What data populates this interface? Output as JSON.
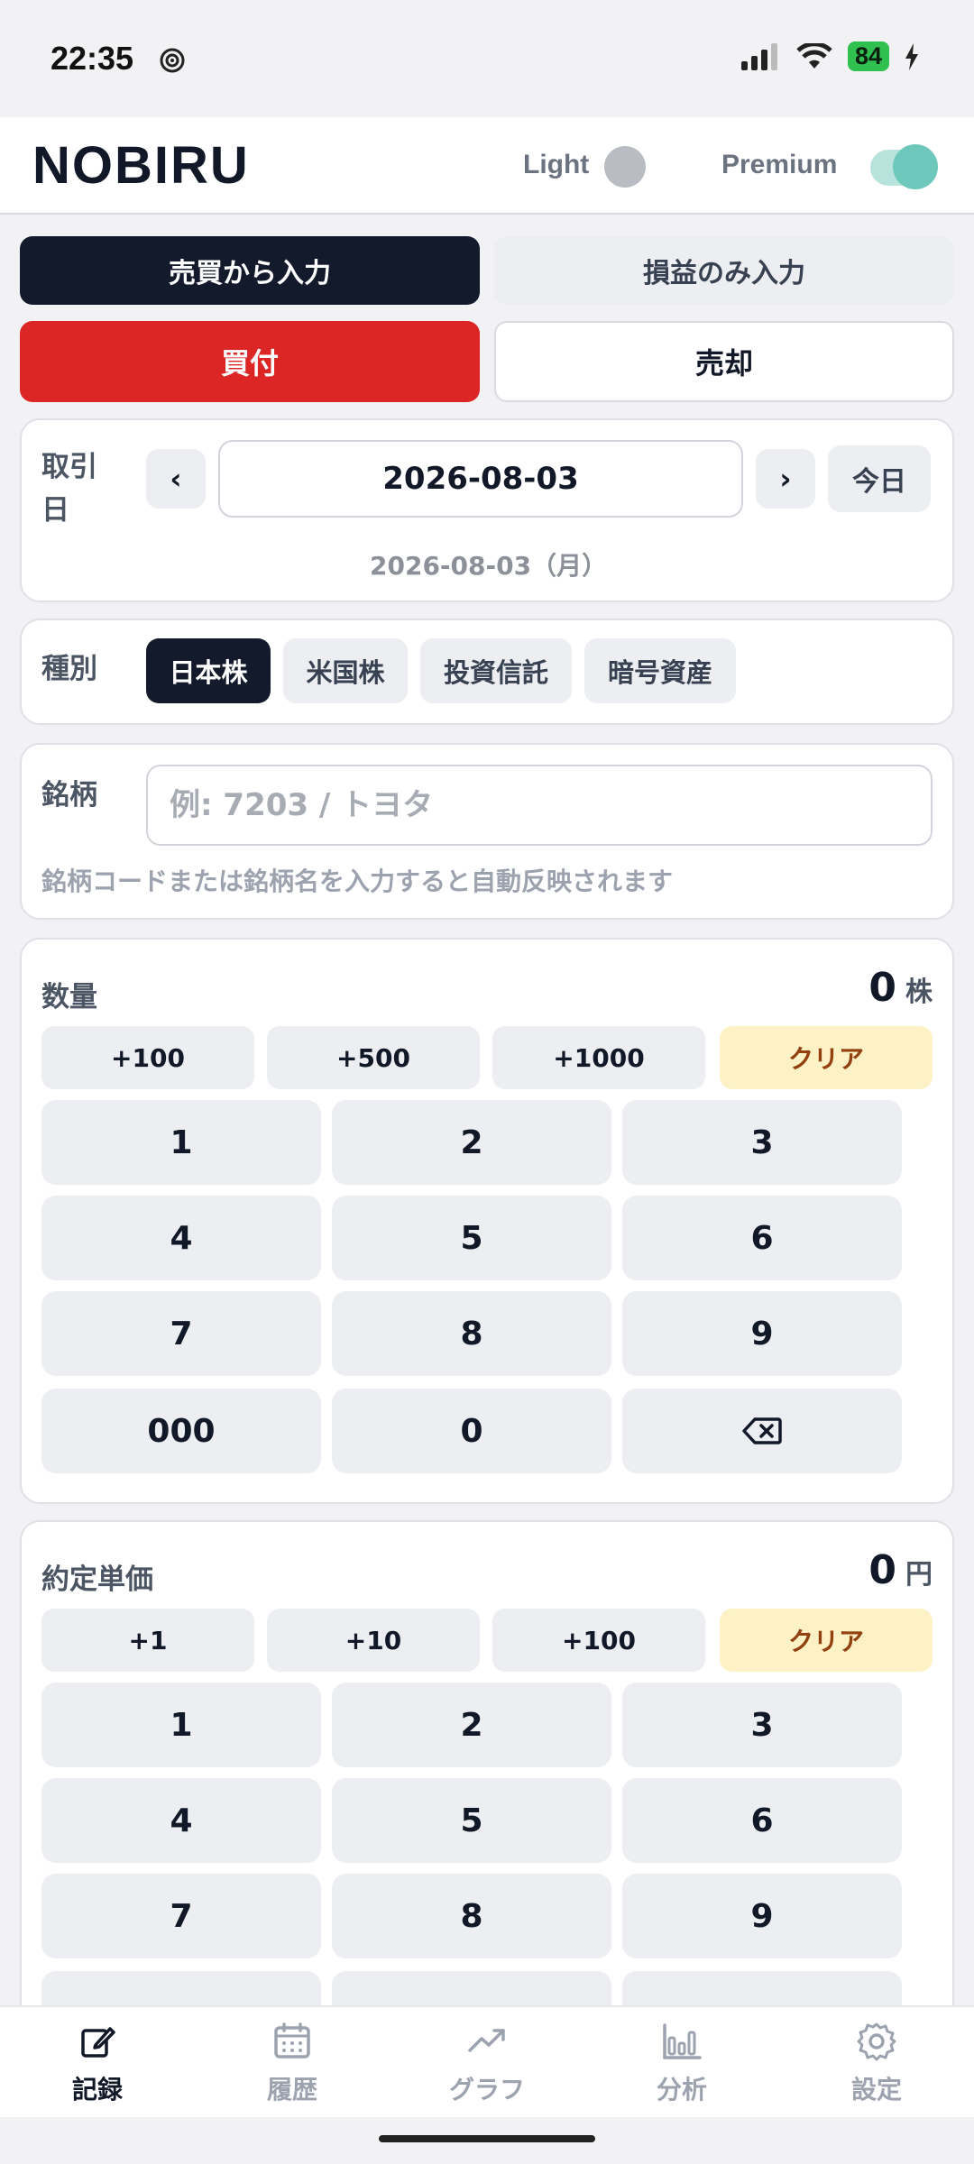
{
  "status_bar": {
    "time": "22:35",
    "battery": "84"
  },
  "header": {
    "logo": "NOBIRU",
    "light_label": "Light",
    "premium_label": "Premium"
  },
  "input_mode": {
    "tabs": [
      "売買から入力",
      "損益のみ入力"
    ],
    "selected": 0
  },
  "trade_side": {
    "buy": "買付",
    "sell": "売却",
    "selected": "buy"
  },
  "date_card": {
    "label": "取引日",
    "label_line1": "取引",
    "label_line2": "日",
    "prev": "‹",
    "value": "2026-08-03",
    "next": "›",
    "today": "今日",
    "formatted": "2026-08-03（月）"
  },
  "type_card": {
    "label": "種別",
    "options": [
      "日本株",
      "米国株",
      "投資信託",
      "暗号資産"
    ],
    "selected": 0
  },
  "ticker_card": {
    "label": "銘柄",
    "placeholder": "例: 7203 / トヨタ",
    "value": "",
    "hint": "銘柄コードまたは銘柄名を入力すると自動反映されます"
  },
  "quantity_card": {
    "label": "数量",
    "value": "0",
    "unit": "株",
    "quick": [
      "+100",
      "+500",
      "+1000"
    ],
    "clear": "クリア",
    "keys": [
      "1",
      "2",
      "3",
      "4",
      "5",
      "6",
      "7",
      "8",
      "9",
      "000",
      "0",
      "⌫"
    ]
  },
  "price_card": {
    "label": "約定単価",
    "value": "0",
    "unit": "円",
    "quick": [
      "+1",
      "+10",
      "+100"
    ],
    "clear": "クリア",
    "keys": [
      "1",
      "2",
      "3",
      "4",
      "5",
      "6",
      "7",
      "8",
      "9"
    ]
  },
  "bottom_nav": {
    "items": [
      "記録",
      "履歴",
      "グラフ",
      "分析",
      "設定"
    ],
    "active": 0,
    "icons": [
      "edit-icon",
      "calendar-icon",
      "trend-icon",
      "bar-chart-icon",
      "gear-icon"
    ]
  },
  "colors": {
    "dark": "#121a2b",
    "buy_red": "#dc2626",
    "clear_bg": "#fdf1c6",
    "premium_teal": "#6dc7bb"
  }
}
